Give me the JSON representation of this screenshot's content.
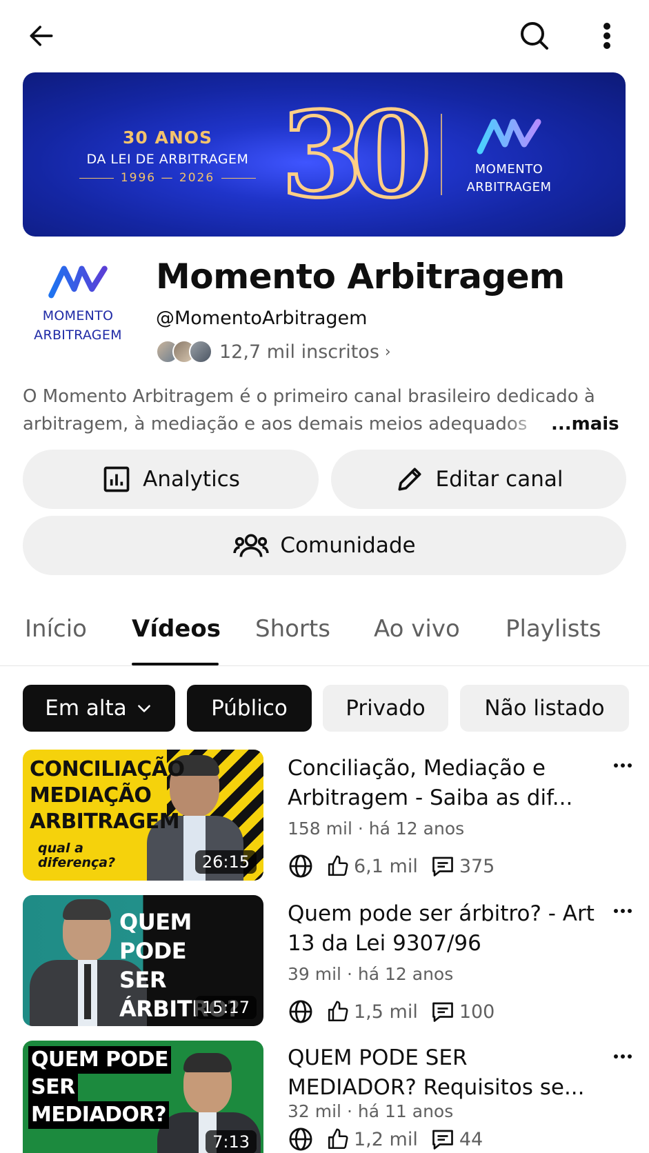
{
  "banner": {
    "anos": "30 ANOS",
    "lei": "DA LEI DE ARBITRAGEM",
    "years": "1996 — 2026",
    "big_number": "30",
    "brand_line1": "MOMENTO",
    "brand_line2": "ARBITRAGEM"
  },
  "channel": {
    "avatar_line1": "MOMENTO",
    "avatar_line2": "ARBITRAGEM",
    "name": "Momento Arbitragem",
    "handle": "@MomentoArbitragem",
    "subscribers": "12,7 mil inscritos",
    "description_line1": "O Momento Arbitragem é o primeiro canal brasileiro dedicado à",
    "description_line2": "arbitragem, à mediação e aos demais meios adequados",
    "more_label": "...mais"
  },
  "actions": {
    "analytics": "Analytics",
    "edit": "Editar canal",
    "community": "Comunidade"
  },
  "tabs": [
    "Início",
    "Vídeos",
    "Shorts",
    "Ao vivo",
    "Playlists"
  ],
  "active_tab": "Vídeos",
  "chips": {
    "sort": "Em alta",
    "public": "Público",
    "private": "Privado",
    "unlisted": "Não listado"
  },
  "videos": [
    {
      "title": "Conciliação, Mediação e Arbitragem - Saiba as dif...",
      "views": "158 mil",
      "age": "há 12 anos",
      "likes": "6,1 mil",
      "comments": "375",
      "duration": "26:15",
      "thumb_line1": "CONCILIAÇÃO",
      "thumb_line2": "MEDIAÇÃO",
      "thumb_line3": "ARBITRAGEM",
      "thumb_sub1": "qual a",
      "thumb_sub2": "diferença?"
    },
    {
      "title": "Quem pode ser árbitro? - Art 13 da Lei 9307/96",
      "views": "39 mil",
      "age": "há 12 anos",
      "likes": "1,5 mil",
      "comments": "100",
      "duration": "15:17",
      "thumb_line1": "QUEM PODE",
      "thumb_line2": "SER",
      "thumb_line3": "ÁRBITRO?"
    },
    {
      "title": "QUEM PODE SER MEDIADOR? Requisitos se...",
      "views": "32 mil",
      "age": "há 11 anos",
      "likes": "1,2 mil",
      "comments": "44",
      "duration": "7:13",
      "thumb_line1": "QUEM PODE",
      "thumb_line2": "SER",
      "thumb_line3": "MEDIADOR?"
    }
  ],
  "meta_separator": "·",
  "colors": {
    "accent_dark": "#0f0f0f",
    "secondary_text": "#606060",
    "chip_bg": "#f0f0f0",
    "brand_blue": "#1f2aa6"
  }
}
